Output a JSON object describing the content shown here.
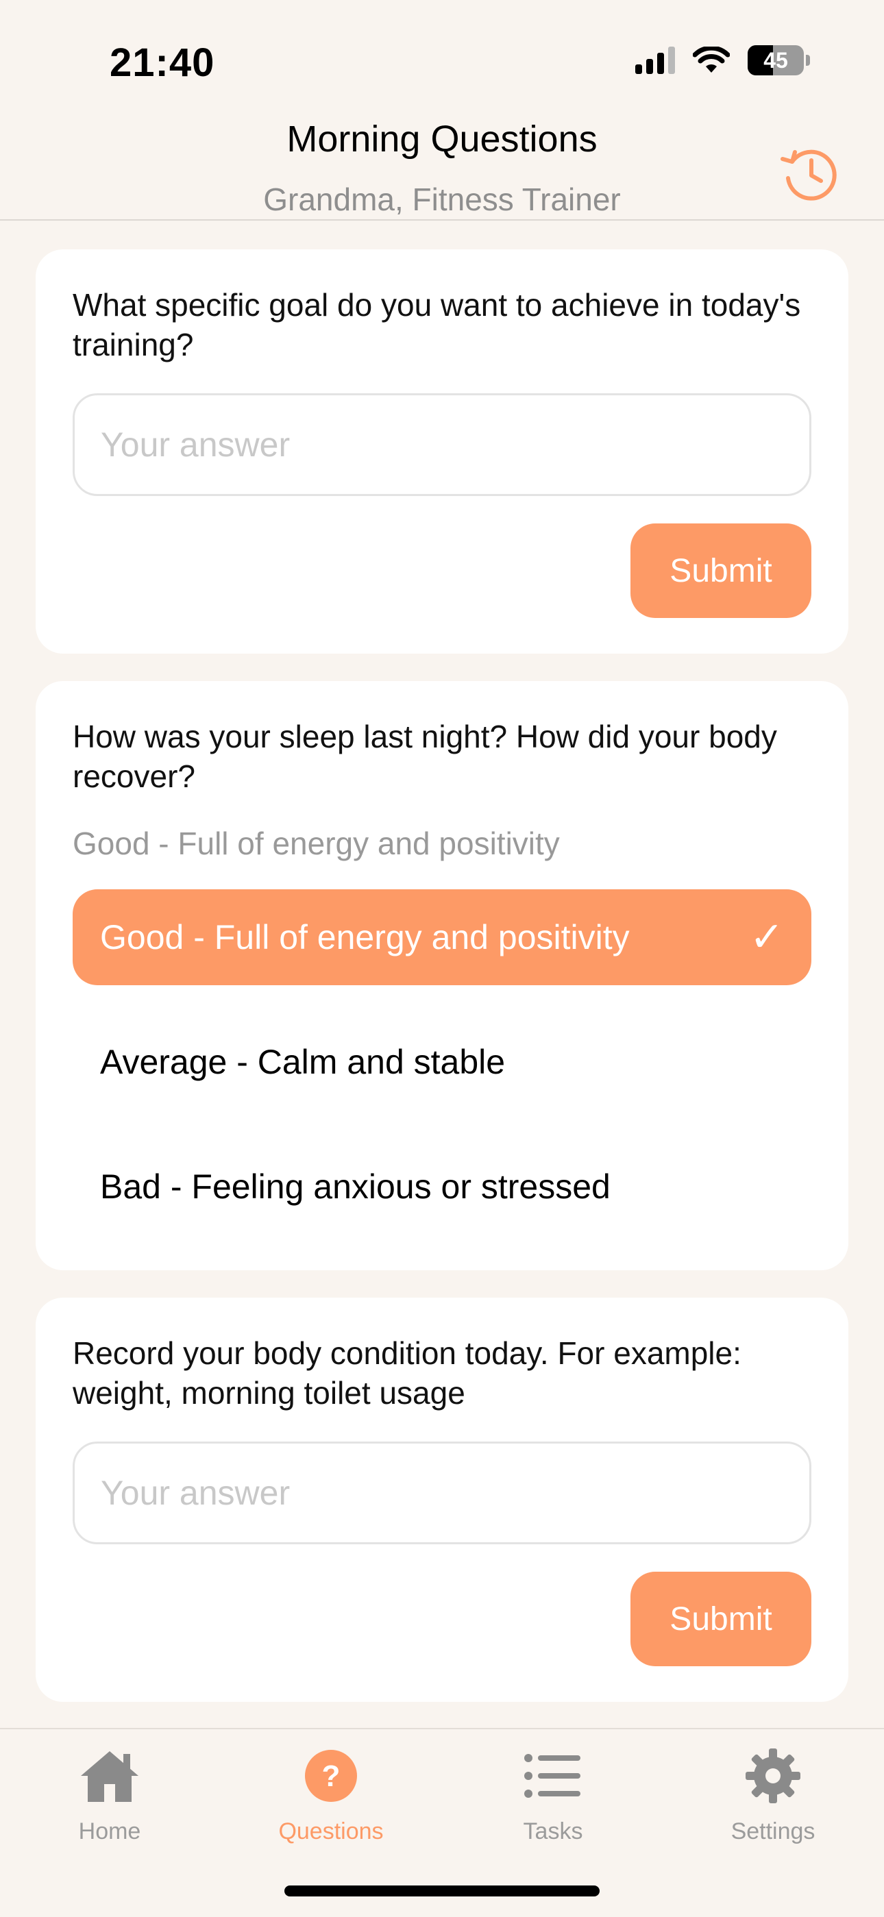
{
  "status_bar": {
    "time": "21:40",
    "battery_percent": "45",
    "battery_level": 0.45,
    "signal_bars": 3,
    "icons": [
      "cellular-signal-icon",
      "wifi-icon",
      "battery-icon"
    ]
  },
  "header": {
    "title": "Morning Questions",
    "subtitle": "Grandma, Fitness Trainer",
    "history_icon": "history-icon"
  },
  "cards": [
    {
      "question": "What specific goal do you want to achieve in today's training?",
      "input_placeholder": "Your answer",
      "input_value": "",
      "submit_label": "Submit"
    },
    {
      "question": "How was your sleep last night? How did your body recover?",
      "selected_text": "Good - Full of energy and positivity",
      "options": [
        "Good - Full of energy and positivity",
        "Average - Calm and stable",
        "Bad - Feeling anxious or stressed"
      ],
      "selected_index": 0,
      "check_glyph": "✓"
    },
    {
      "question": "Record your body condition today. For example: weight, morning toilet usage",
      "input_placeholder": "Your answer",
      "input_value": "",
      "submit_label": "Submit"
    }
  ],
  "tabbar": {
    "tabs": [
      {
        "label": "Home",
        "icon": "home-icon",
        "active": false
      },
      {
        "label": "Questions",
        "icon": "question-icon",
        "active": true
      },
      {
        "label": "Tasks",
        "icon": "list-icon",
        "active": false
      },
      {
        "label": "Settings",
        "icon": "gear-icon",
        "active": false
      }
    ]
  },
  "colors": {
    "accent": "#fd9a66",
    "background": "#f9f4ef",
    "card": "#ffffff",
    "muted_text": "#9b9b9b"
  }
}
